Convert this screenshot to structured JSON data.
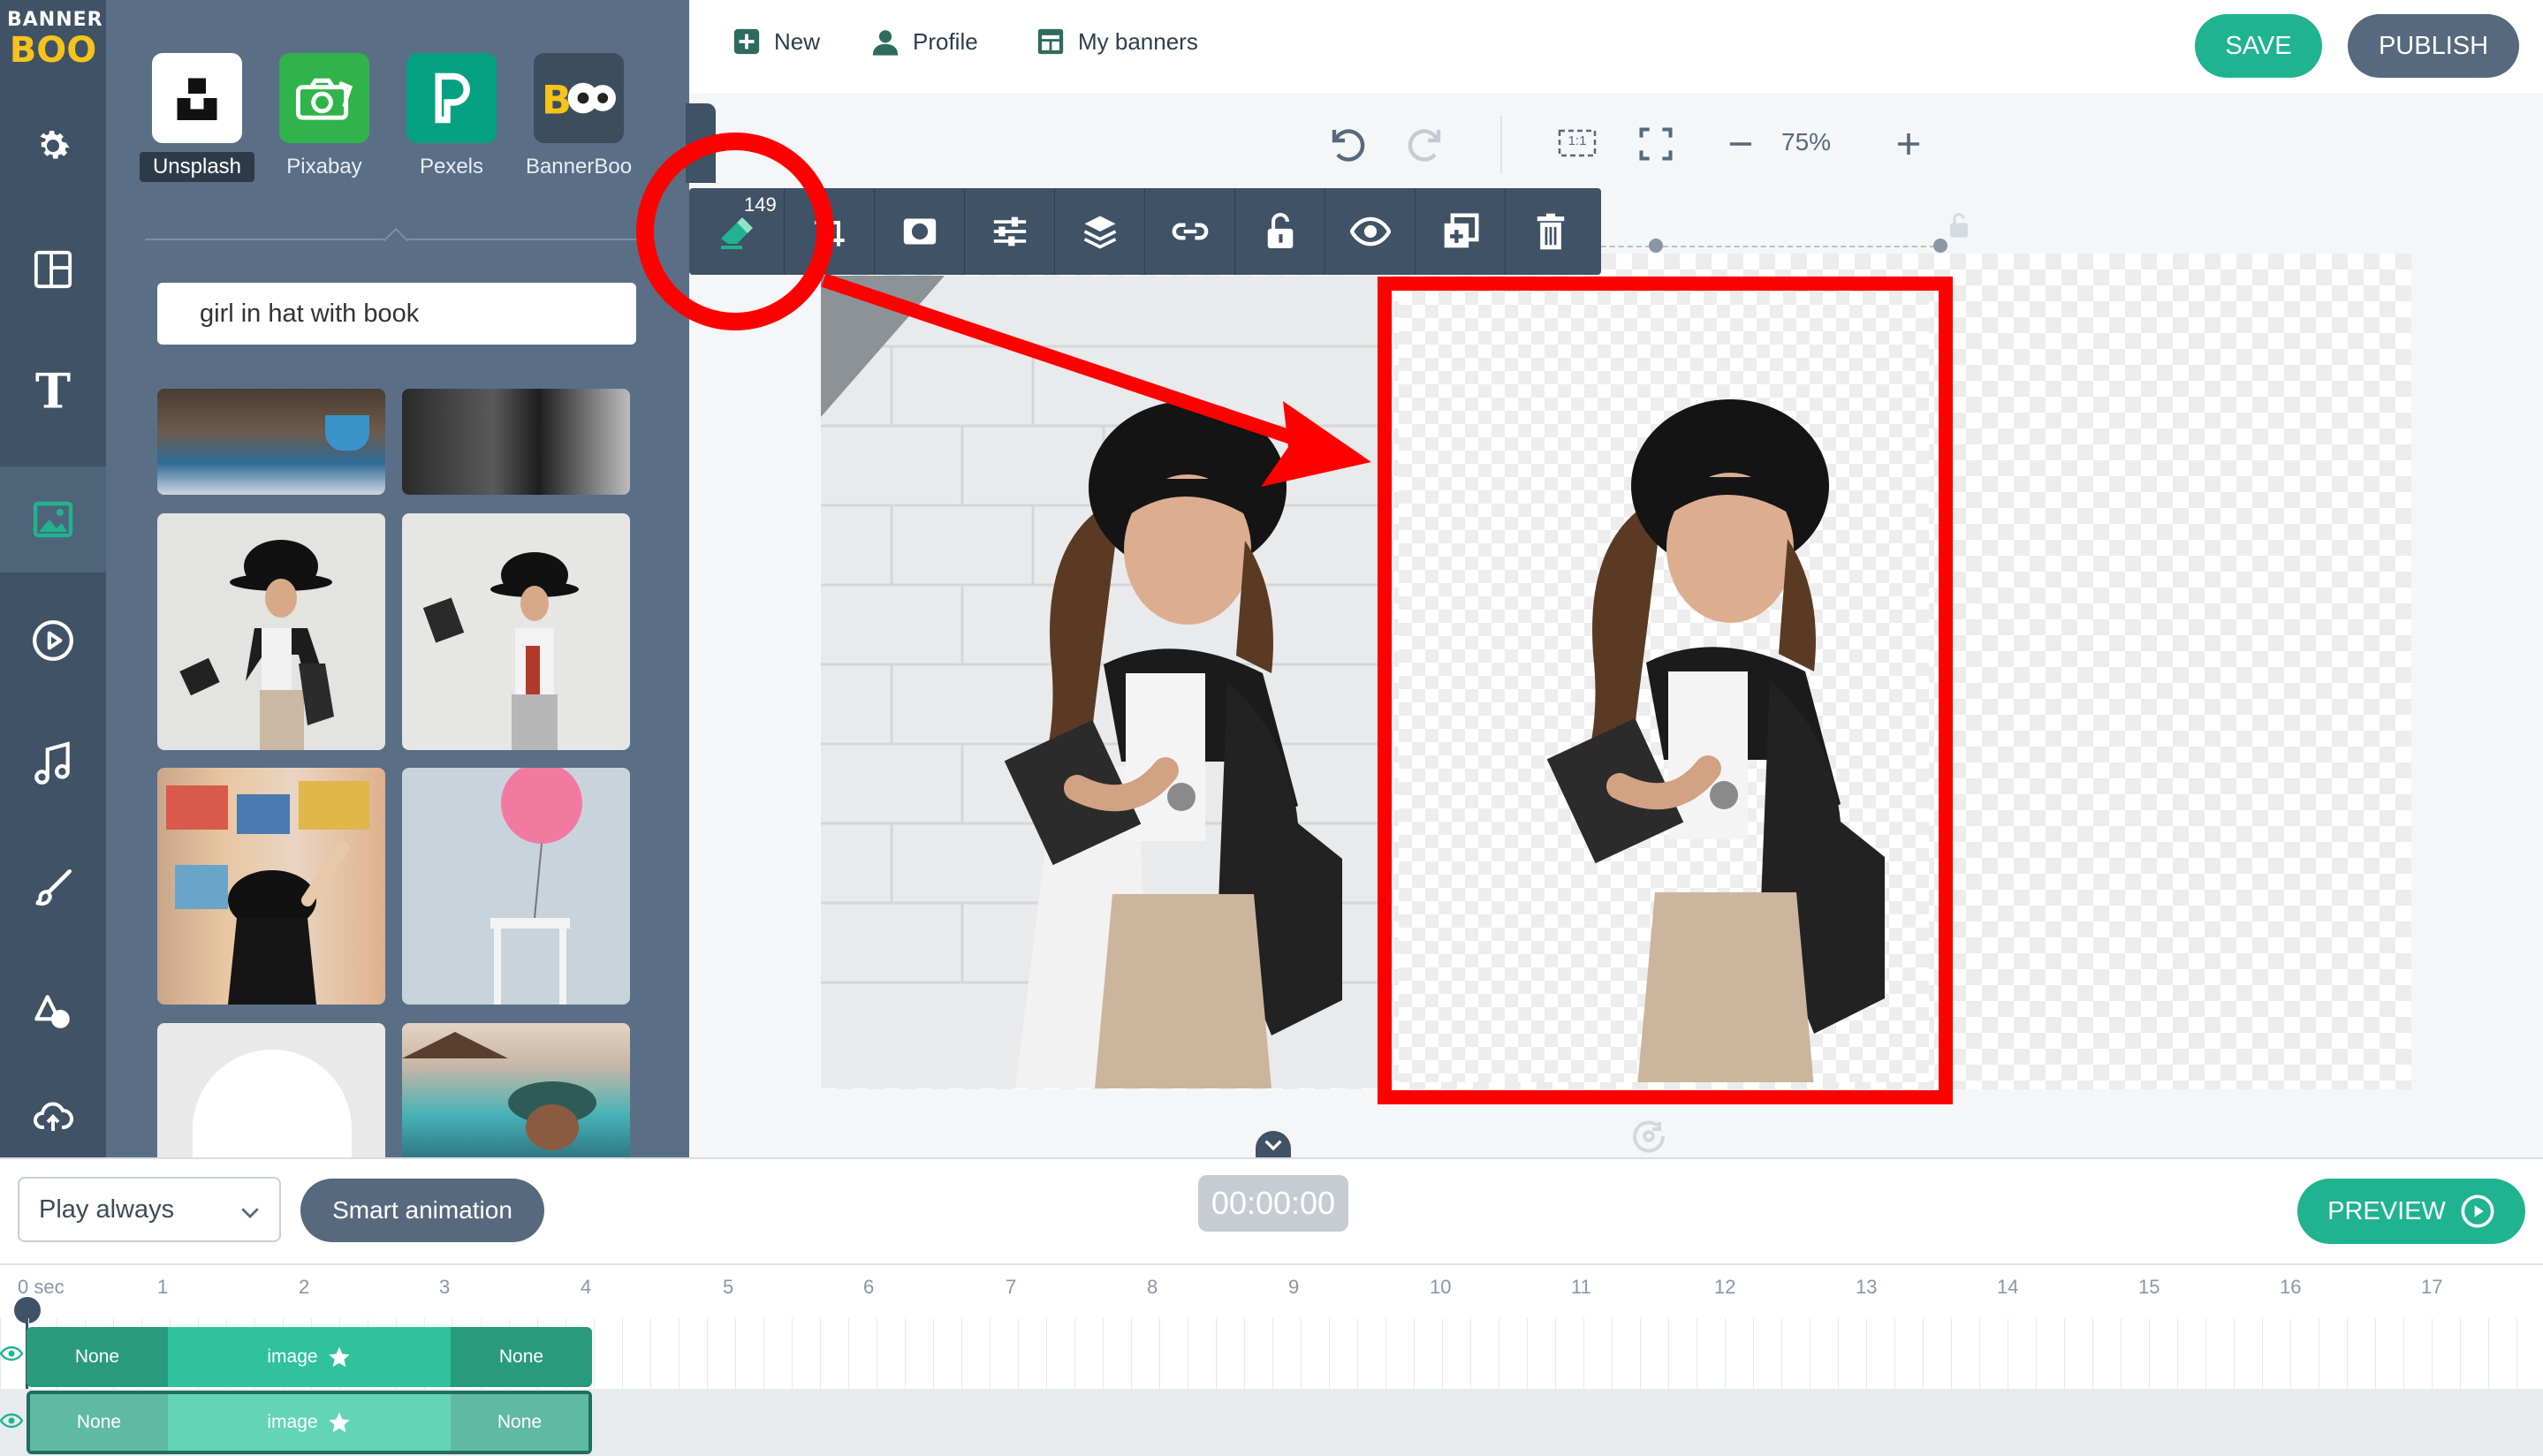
{
  "brand": {
    "logo_top": "BANNER",
    "logo_bottom": "BOO"
  },
  "rail": {
    "items": [
      {
        "name": "settings"
      },
      {
        "name": "templates"
      },
      {
        "name": "text"
      },
      {
        "name": "images",
        "active": true
      },
      {
        "name": "video"
      },
      {
        "name": "audio"
      },
      {
        "name": "draw"
      },
      {
        "name": "shapes"
      },
      {
        "name": "upload"
      }
    ]
  },
  "library": {
    "sources": [
      {
        "label": "Unsplash",
        "selected": true
      },
      {
        "label": "Pixabay"
      },
      {
        "label": "Pexels"
      },
      {
        "label": "BannerBoo"
      }
    ],
    "search_value": "girl in hat with book"
  },
  "topnav": {
    "new_label": "New",
    "profile_label": "Profile",
    "my_banners_label": "My banners",
    "save_label": "SAVE",
    "publish_label": "PUBLISH"
  },
  "zoom": {
    "value": "75%",
    "fit_label": "1:1"
  },
  "element_toolbar": {
    "badge": "149"
  },
  "bottom": {
    "play_mode": "Play always",
    "smart_animation_label": "Smart animation",
    "timecode": "00:00:00",
    "preview_label": "PREVIEW"
  },
  "timeline": {
    "ticks": [
      "0 sec",
      "1",
      "2",
      "3",
      "4",
      "5",
      "6",
      "7",
      "8",
      "9",
      "10",
      "11",
      "12",
      "13",
      "14",
      "15",
      "16",
      "17"
    ],
    "tracks": [
      {
        "in": "None",
        "name": "image",
        "out": "None"
      },
      {
        "in": "None",
        "name": "image",
        "out": "None",
        "selected": true
      }
    ]
  },
  "colors": {
    "accent": "#20b38f",
    "rail": "#3f5266",
    "panel": "#5a6f86",
    "annotation": "#ff0000"
  }
}
